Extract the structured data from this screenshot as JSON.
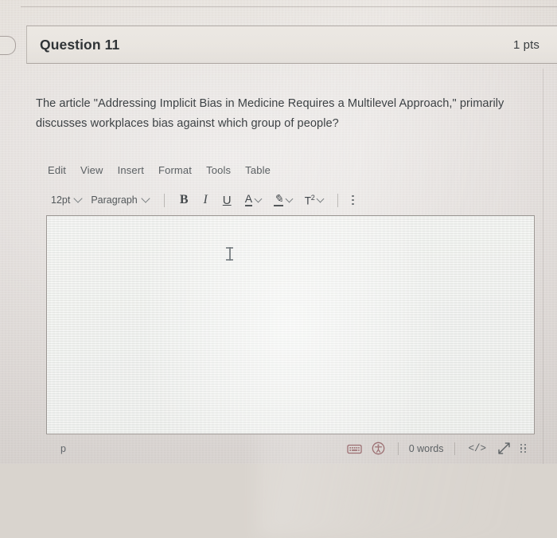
{
  "question": {
    "title": "Question 11",
    "points": "1 pts",
    "prompt": "The article \"Addressing Implicit Bias in Medicine Requires a Multilevel Approach,\" primarily discusses workplaces bias against which group of people?"
  },
  "editor": {
    "menubar": [
      {
        "label": "Edit"
      },
      {
        "label": "View"
      },
      {
        "label": "Insert"
      },
      {
        "label": "Format"
      },
      {
        "label": "Tools"
      },
      {
        "label": "Table"
      }
    ],
    "toolbar": {
      "font_size": "12pt",
      "block_format": "Paragraph",
      "bold": "B",
      "italic": "I",
      "underline": "U",
      "text_color": "A",
      "highlight_color": "✎",
      "superscript": "T",
      "superscript_exp": "2",
      "more_options": "more-options"
    },
    "content": "",
    "statusbar": {
      "element_path": "p",
      "keyboard_icon": "keyboard-icon",
      "accessibility_icon": "accessibility-checker-icon",
      "word_count": "0 words",
      "html_editor": "</>",
      "fullscreen_icon": "expand-arrow-icon",
      "resize_handle": "resize-grip-icon"
    }
  },
  "colors": {
    "page_bg": "#e3ded9",
    "header_bg": "#eae6e1",
    "editor_bg": "#f5f6f4",
    "border": "#847e7a",
    "text": "#3d4245",
    "status_icon": "#9c6f72"
  }
}
